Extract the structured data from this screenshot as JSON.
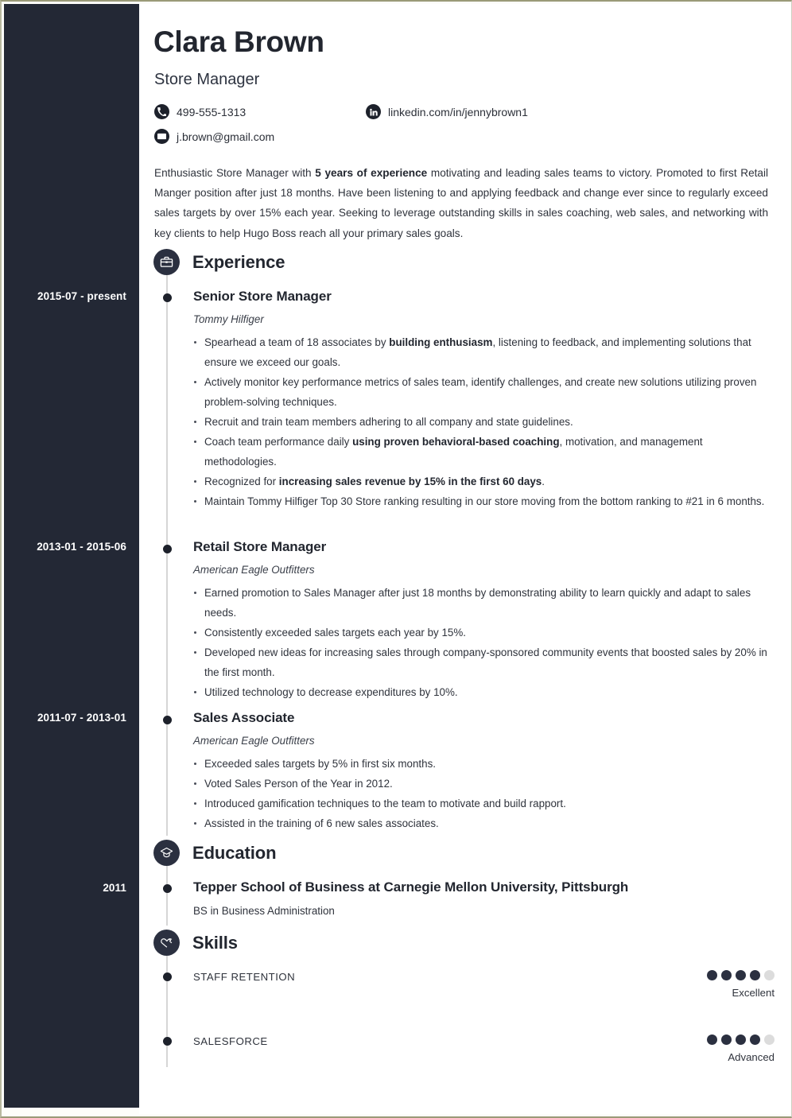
{
  "header": {
    "name": "Clara Brown",
    "job_title": "Store Manager",
    "contacts": {
      "phone": "499-555-1313",
      "email": "j.brown@gmail.com",
      "linkedin": "linkedin.com/in/jennybrown1"
    }
  },
  "summary": {
    "part1": "Enthusiastic Store Manager with ",
    "bold1": "5 years of experience",
    "part2": " motivating and leading sales teams to victory. Promoted to first Retail Manger position after just 18 months. Have been listening to and applying feedback and change ever since to regularly exceed sales targets by over 15% each year. Seeking to leverage outstanding skills in sales coaching, web sales, and networking with key clients to help Hugo Boss reach all your primary sales goals."
  },
  "sections": {
    "experience": {
      "title": "Experience",
      "icon": "briefcase-icon",
      "entries": [
        {
          "date": "2015-07 - present",
          "title": "Senior Store Manager",
          "company": "Tommy Hilfiger",
          "bullets": [
            {
              "pre": "Spearhead a team of 18 associates by ",
              "bold": "building enthusiasm",
              "post": ", listening to feedback, and implementing solutions that ensure we exceed our goals."
            },
            {
              "pre": "Actively monitor key performance metrics of sales team, identify challenges, and create new solutions utilizing proven problem-solving techniques.",
              "bold": "",
              "post": ""
            },
            {
              "pre": "Recruit and train team members adhering to all company and state guidelines.",
              "bold": "",
              "post": ""
            },
            {
              "pre": "Coach team performance daily ",
              "bold": "using proven behavioral-based coaching",
              "post": ", motivation, and management methodologies."
            },
            {
              "pre": "Recognized for ",
              "bold": "increasing sales revenue by 15% in the first 60 days",
              "post": "."
            },
            {
              "pre": "Maintain Tommy Hilfiger Top 30 Store ranking resulting in our store moving from the bottom ranking to #21 in 6 months.",
              "bold": "",
              "post": ""
            }
          ]
        },
        {
          "date": "2013-01 - 2015-06",
          "title": "Retail Store Manager",
          "company": "American Eagle Outfitters",
          "bullets": [
            {
              "pre": "Earned promotion to Sales Manager after just 18 months by demonstrating ability to learn quickly and adapt to sales needs.",
              "bold": "",
              "post": ""
            },
            {
              "pre": "Consistently exceeded sales targets each year by 15%.",
              "bold": "",
              "post": ""
            },
            {
              "pre": "Developed new ideas for increasing sales through company-sponsored community events that boosted sales by 20% in the first month.",
              "bold": "",
              "post": ""
            },
            {
              "pre": "Utilized technology to decrease expenditures by 10%.",
              "bold": "",
              "post": ""
            }
          ]
        },
        {
          "date": "2011-07 - 2013-01",
          "title": "Sales Associate",
          "company": "American Eagle Outfitters",
          "bullets": [
            {
              "pre": "Exceeded sales targets by 5% in first six months.",
              "bold": "",
              "post": ""
            },
            {
              "pre": "Voted Sales Person of the Year in 2012.",
              "bold": "",
              "post": ""
            },
            {
              "pre": "Introduced gamification techniques to the team to motivate and build rapport.",
              "bold": "",
              "post": ""
            },
            {
              "pre": "Assisted in the training of 6 new sales associates.",
              "bold": "",
              "post": ""
            }
          ]
        }
      ]
    },
    "education": {
      "title": "Education",
      "icon": "graduation-cap-icon",
      "entries": [
        {
          "date": "2011",
          "title": "Tepper School of Business at Carnegie Mellon University, Pittsburgh",
          "degree": "BS in Business Administration"
        }
      ]
    },
    "skills": {
      "title": "Skills",
      "icon": "hand-heart-icon",
      "items": [
        {
          "name": "STAFF RETENTION",
          "level": "Excellent",
          "filled": 4,
          "total": 5
        },
        {
          "name": "SALESFORCE",
          "level": "Advanced",
          "filled": 4,
          "total": 5
        }
      ]
    }
  },
  "colors": {
    "sidebar": "#232835",
    "accent": "#2b3040",
    "dot_off": "#dcdcdc"
  }
}
